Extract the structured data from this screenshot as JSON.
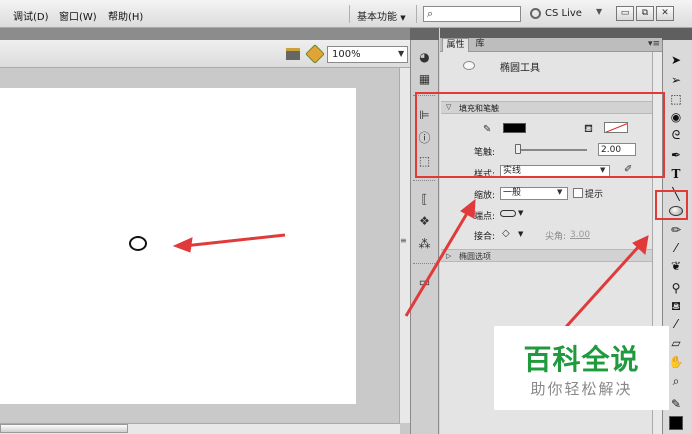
{
  "menubar": {
    "items": [
      "调试(D)",
      "窗口(W)",
      "帮助(H)"
    ],
    "workspace_label": "基本功能",
    "workspace_arrow": "▼",
    "search_placeholder": "",
    "cslive_label": "CS Live",
    "window_buttons": [
      "▭",
      "⧉",
      "✕"
    ]
  },
  "stage": {
    "zoom_value": "100%",
    "background": "#ffffff"
  },
  "properties": {
    "tabs": [
      "属性",
      "库"
    ],
    "tool_name": "椭圆工具",
    "section_fill_stroke": "填充和笔触",
    "stroke_label": "笔触:",
    "stroke_value": "2.00",
    "style_label": "样式:",
    "style_value": "实线",
    "scale_label": "缩放:",
    "scale_value": "一般",
    "hint_label": "提示",
    "cap_label": "端点:",
    "join_label": "接合:",
    "miter_label": "尖角:",
    "miter_value": "3.00",
    "section_oval": "椭圆选项",
    "stroke_color": "#000000",
    "fill_color": "none"
  },
  "toolbox": {
    "tools": [
      "selection-tool",
      "subselection-tool",
      "free-transform-tool",
      "3d-rotation-tool",
      "lasso-tool",
      "pen-tool",
      "text-tool",
      "line-tool",
      "oval-tool",
      "pencil-tool",
      "brush-tool",
      "deco-tool",
      "bone-tool",
      "paint-bucket-tool",
      "eyedropper-tool",
      "eraser-tool",
      "hand-tool",
      "zoom-tool",
      "stroke-color-tool"
    ]
  },
  "watermark": {
    "title": "百科全说",
    "subtitle": "助你轻松解决"
  },
  "colors": {
    "annotation_red": "#e03a3a",
    "watermark_green": "#1f9a3c"
  }
}
